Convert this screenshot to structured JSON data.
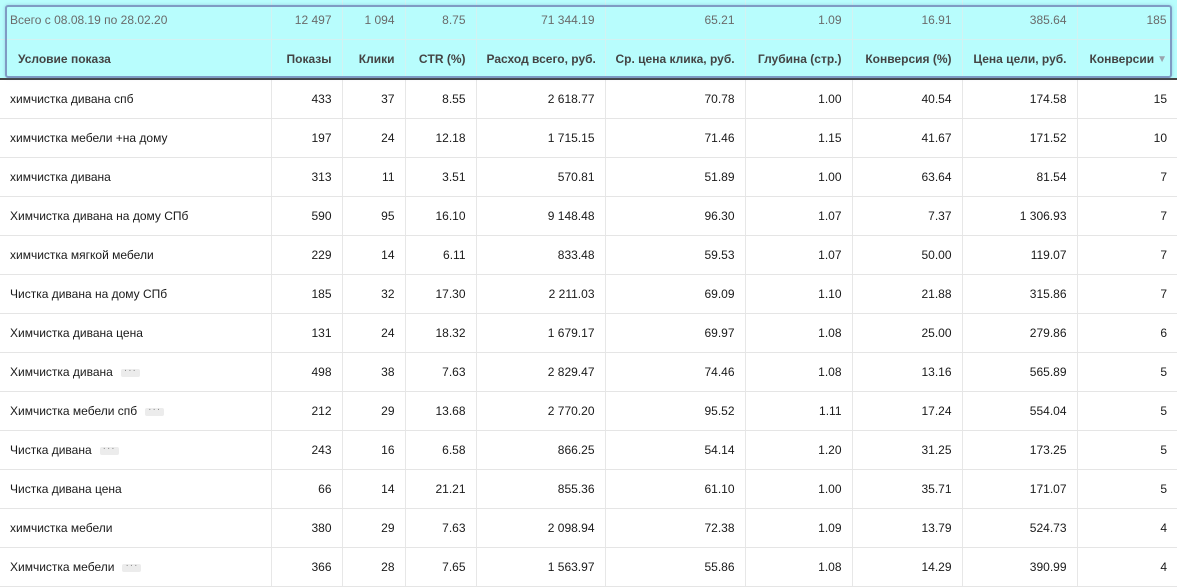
{
  "totals": {
    "label": "Всего с 08.08.19 по 28.02.20",
    "shows": "12 497",
    "clicks": "1 094",
    "ctr": "8.75",
    "cost": "71 344.19",
    "cpc": "65.21",
    "depth": "1.09",
    "conversion_rate": "16.91",
    "goal_price": "385.64",
    "conversions": "185"
  },
  "columns": {
    "name": "Условие показа",
    "shows": "Показы",
    "clicks": "Клики",
    "ctr": "CTR (%)",
    "cost": "Расход всего, руб.",
    "cpc": "Ср. цена клика, руб.",
    "depth": "Глубина (стр.)",
    "conversion_rate": "Конверсия (%)",
    "goal_price": "Цена цели, руб.",
    "conversions": "Конверсии",
    "sort_icon": "triangle-down-icon"
  },
  "more_glyph": "···",
  "rows": [
    {
      "name": "химчистка дивана спб",
      "more": false,
      "shows": "433",
      "clicks": "37",
      "ctr": "8.55",
      "cost": "2 618.77",
      "cpc": "70.78",
      "depth": "1.00",
      "conversion_rate": "40.54",
      "goal_price": "174.58",
      "conversions": "15"
    },
    {
      "name": "химчистка мебели +на дому",
      "more": false,
      "shows": "197",
      "clicks": "24",
      "ctr": "12.18",
      "cost": "1 715.15",
      "cpc": "71.46",
      "depth": "1.15",
      "conversion_rate": "41.67",
      "goal_price": "171.52",
      "conversions": "10"
    },
    {
      "name": "химчистка дивана",
      "more": false,
      "shows": "313",
      "clicks": "11",
      "ctr": "3.51",
      "cost": "570.81",
      "cpc": "51.89",
      "depth": "1.00",
      "conversion_rate": "63.64",
      "goal_price": "81.54",
      "conversions": "7"
    },
    {
      "name": "Химчистка дивана на дому СПб",
      "more": false,
      "shows": "590",
      "clicks": "95",
      "ctr": "16.10",
      "cost": "9 148.48",
      "cpc": "96.30",
      "depth": "1.07",
      "conversion_rate": "7.37",
      "goal_price": "1 306.93",
      "conversions": "7"
    },
    {
      "name": "химчистка мягкой мебели",
      "more": false,
      "shows": "229",
      "clicks": "14",
      "ctr": "6.11",
      "cost": "833.48",
      "cpc": "59.53",
      "depth": "1.07",
      "conversion_rate": "50.00",
      "goal_price": "119.07",
      "conversions": "7"
    },
    {
      "name": "Чистка дивана на дому СПб",
      "more": false,
      "shows": "185",
      "clicks": "32",
      "ctr": "17.30",
      "cost": "2 211.03",
      "cpc": "69.09",
      "depth": "1.10",
      "conversion_rate": "21.88",
      "goal_price": "315.86",
      "conversions": "7"
    },
    {
      "name": "Химчистка дивана цена",
      "more": false,
      "shows": "131",
      "clicks": "24",
      "ctr": "18.32",
      "cost": "1 679.17",
      "cpc": "69.97",
      "depth": "1.08",
      "conversion_rate": "25.00",
      "goal_price": "279.86",
      "conversions": "6"
    },
    {
      "name": "Химчистка дивана",
      "more": true,
      "shows": "498",
      "clicks": "38",
      "ctr": "7.63",
      "cost": "2 829.47",
      "cpc": "74.46",
      "depth": "1.08",
      "conversion_rate": "13.16",
      "goal_price": "565.89",
      "conversions": "5"
    },
    {
      "name": "Химчистка мебели спб",
      "more": true,
      "shows": "212",
      "clicks": "29",
      "ctr": "13.68",
      "cost": "2 770.20",
      "cpc": "95.52",
      "depth": "1.11",
      "conversion_rate": "17.24",
      "goal_price": "554.04",
      "conversions": "5"
    },
    {
      "name": "Чистка дивана",
      "more": true,
      "shows": "243",
      "clicks": "16",
      "ctr": "6.58",
      "cost": "866.25",
      "cpc": "54.14",
      "depth": "1.20",
      "conversion_rate": "31.25",
      "goal_price": "173.25",
      "conversions": "5"
    },
    {
      "name": "Чистка дивана цена",
      "more": false,
      "shows": "66",
      "clicks": "14",
      "ctr": "21.21",
      "cost": "855.36",
      "cpc": "61.10",
      "depth": "1.00",
      "conversion_rate": "35.71",
      "goal_price": "171.07",
      "conversions": "5"
    },
    {
      "name": "химчистка мебели",
      "more": false,
      "shows": "380",
      "clicks": "29",
      "ctr": "7.63",
      "cost": "2 098.94",
      "cpc": "72.38",
      "depth": "1.09",
      "conversion_rate": "13.79",
      "goal_price": "524.73",
      "conversions": "4"
    },
    {
      "name": "Химчистка мебели",
      "more": true,
      "shows": "366",
      "clicks": "28",
      "ctr": "7.65",
      "cost": "1 563.97",
      "cpc": "55.86",
      "depth": "1.08",
      "conversion_rate": "14.29",
      "goal_price": "390.99",
      "conversions": "4"
    }
  ]
}
